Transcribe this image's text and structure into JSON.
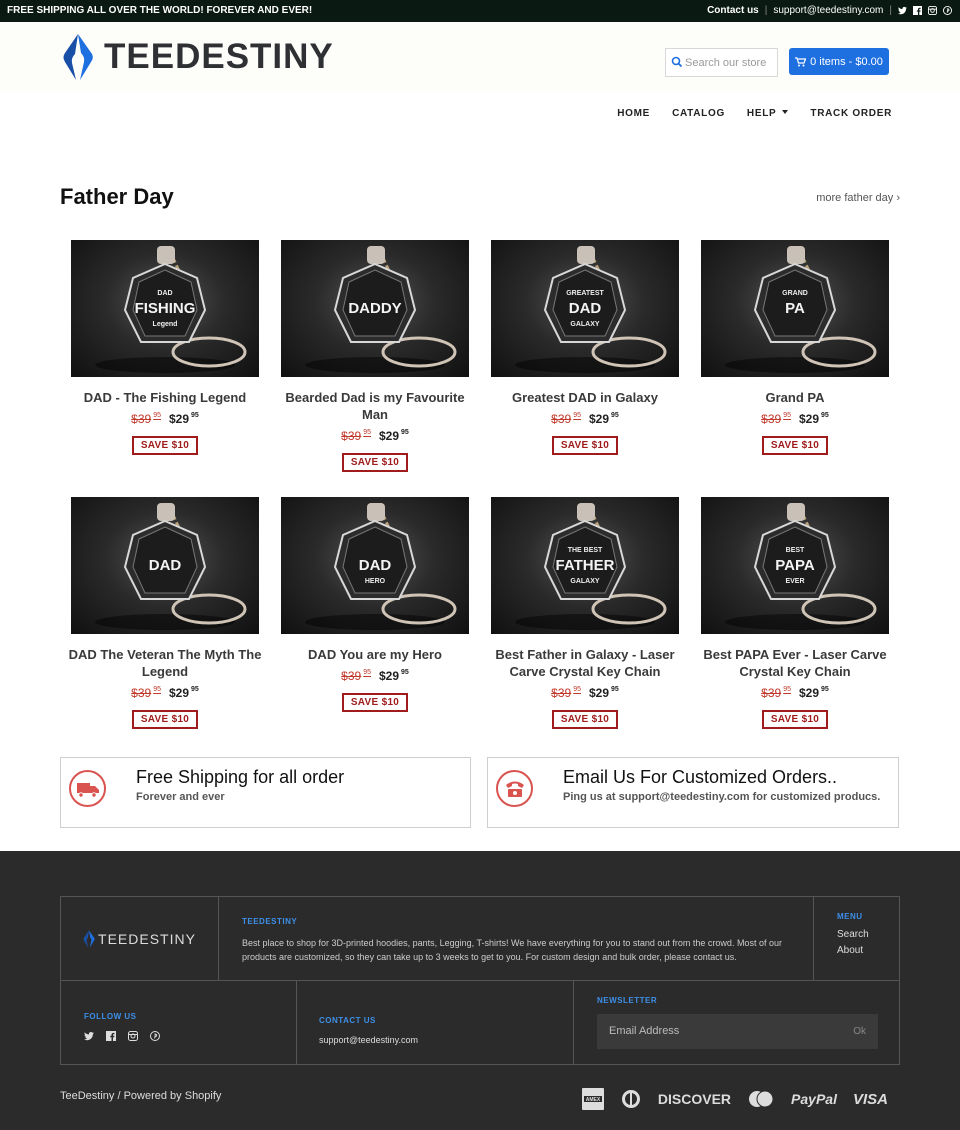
{
  "topbar": {
    "promo": "FREE SHIPPING ALL OVER THE WORLD! FOREVER AND EVER!",
    "contact_label": "Contact us",
    "email": "support@teedestiny.com",
    "social_icons": [
      "twitter-icon",
      "facebook-icon",
      "instagram-icon",
      "pinterest-icon"
    ]
  },
  "header": {
    "logo_text": "TEEDESTINY",
    "search_placeholder": "Search our store",
    "cart_label": "0 items - $0.00",
    "accent_color": "#1e6fe0"
  },
  "nav": {
    "items": [
      {
        "label": "HOME"
      },
      {
        "label": "CATALOG"
      },
      {
        "label": "HELP"
      },
      {
        "label": "TRACK ORDER"
      }
    ]
  },
  "section": {
    "title": "Father Day",
    "more_link": "more father day ›"
  },
  "products": [
    {
      "title": "DAD - The Fishing Legend",
      "old_price": "$39",
      "old_cents": "95",
      "price": "$29",
      "cents": "95",
      "badge": "SAVE $10",
      "engraving": [
        "DAD",
        "FISHING",
        "Legend"
      ]
    },
    {
      "title": "Bearded Dad is my Favourite Man",
      "old_price": "$39",
      "old_cents": "95",
      "price": "$29",
      "cents": "95",
      "badge": "SAVE $10",
      "engraving": [
        "",
        "DADDY",
        ""
      ]
    },
    {
      "title": "Greatest DAD in Galaxy",
      "old_price": "$39",
      "old_cents": "95",
      "price": "$29",
      "cents": "95",
      "badge": "SAVE $10",
      "engraving": [
        "GREATEST",
        "DAD",
        "GALAXY"
      ]
    },
    {
      "title": "Grand PA",
      "old_price": "$39",
      "old_cents": "95",
      "price": "$29",
      "cents": "95",
      "badge": "SAVE $10",
      "engraving": [
        "GRAND",
        "PA",
        ""
      ]
    },
    {
      "title": "DAD The Veteran The Myth The Legend",
      "old_price": "$39",
      "old_cents": "95",
      "price": "$29",
      "cents": "95",
      "badge": "SAVE $10",
      "engraving": [
        "",
        "DAD",
        ""
      ]
    },
    {
      "title": "DAD You are my Hero",
      "old_price": "$39",
      "old_cents": "95",
      "price": "$29",
      "cents": "95",
      "badge": "SAVE $10",
      "engraving": [
        "",
        "DAD",
        "HERO"
      ]
    },
    {
      "title": "Best Father in Galaxy - Laser Carve Crystal Key Chain",
      "old_price": "$39",
      "old_cents": "95",
      "price": "$29",
      "cents": "95",
      "badge": "SAVE $10",
      "engraving": [
        "THE BEST",
        "FATHER",
        "GALAXY"
      ]
    },
    {
      "title": "Best PAPA Ever - Laser Carve Crystal Key Chain",
      "old_price": "$39",
      "old_cents": "95",
      "price": "$29",
      "cents": "95",
      "badge": "SAVE $10",
      "engraving": [
        "BEST",
        "PAPA",
        "EVER"
      ]
    }
  ],
  "info": {
    "shipping": {
      "title": "Free Shipping for all order",
      "subtitle": "Forever and ever",
      "icon": "truck-icon"
    },
    "email": {
      "title": "Email Us For Customized Orders..",
      "subtitle": "Ping us at support@teedestiny.com for customized producs.",
      "icon": "phone-icon"
    }
  },
  "footer": {
    "logo_text": "TEEDESTINY",
    "about_heading": "TEEDESTINY",
    "about_text": "Best place to shop for 3D-printed hoodies, pants, Legging, T-shirts! We have everything for you to stand out from the crowd. Most of our products are customized, so they can take up to 3 weeks to get to you. For custom design and bulk order, please contact us.",
    "menu_heading": "MENU",
    "menu_items": [
      "Search",
      "About"
    ],
    "follow_heading": "FOLLOW US",
    "contact_heading": "CONTACT US",
    "contact_email": "support@teedestiny.com",
    "newsletter_heading": "NEWSLETTER",
    "newsletter_placeholder": "Email Address",
    "newsletter_button": "Ok",
    "copyright": "TeeDestiny / Powered by Shopify",
    "payments": [
      "AMEX",
      "DISCOVER",
      "PayPal",
      "VISA"
    ],
    "heading_color": "#3d8fe8"
  }
}
